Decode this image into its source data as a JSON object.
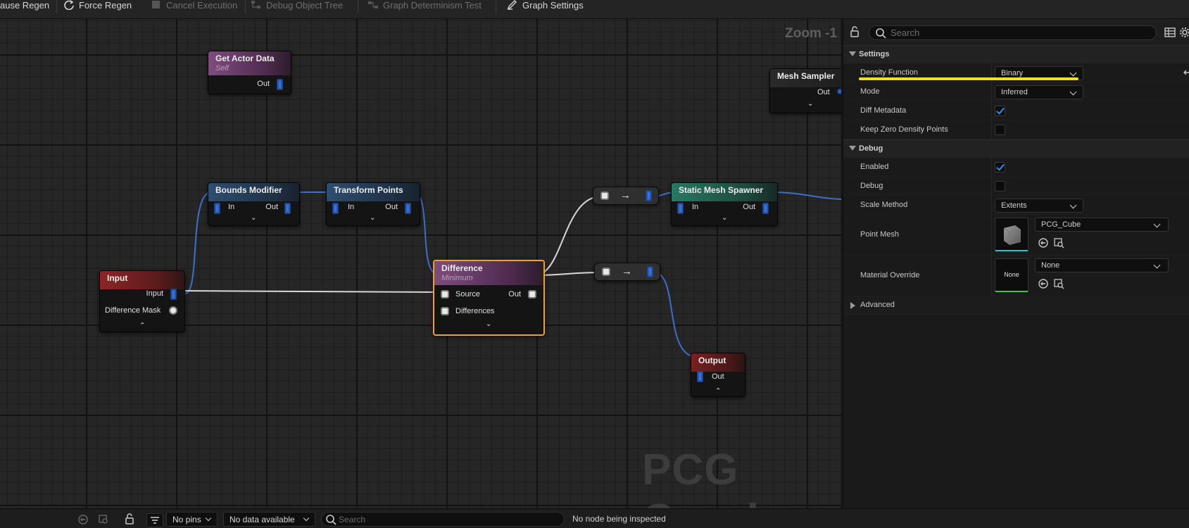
{
  "toolbar": {
    "pause_regen": "ause Regen",
    "force_regen": "Force Regen",
    "cancel_execution": "Cancel Execution",
    "debug_object_tree": "Debug Object Tree",
    "graph_determinism_test": "Graph Determinism Test",
    "graph_settings": "Graph Settings"
  },
  "graph": {
    "zoom": "Zoom -1",
    "watermark": "PCG Graph",
    "nodes": {
      "get_actor_data": {
        "title": "Get Actor Data",
        "subtitle": "Self",
        "out": "Out"
      },
      "mesh_sampler": {
        "title": "Mesh Sampler",
        "out": "Out"
      },
      "bounds_modifier": {
        "title": "Bounds Modifier",
        "in": "In",
        "out": "Out"
      },
      "transform_points": {
        "title": "Transform Points",
        "in": "In",
        "out": "Out"
      },
      "static_mesh_spawner": {
        "title": "Static Mesh Spawner",
        "in": "In",
        "out": "Out"
      },
      "input": {
        "title": "Input",
        "pin_input": "Input",
        "pin_mask": "Difference Mask"
      },
      "difference": {
        "title": "Difference",
        "subtitle": "Minimum",
        "source": "Source",
        "differences": "Differences",
        "out": "Out"
      },
      "output": {
        "title": "Output",
        "out": "Out"
      }
    }
  },
  "details": {
    "search_placeholder": "Search",
    "sections": {
      "settings": "Settings",
      "debug": "Debug",
      "advanced": "Advanced"
    },
    "settings": {
      "density_function": {
        "label": "Density Function",
        "value": "Binary"
      },
      "mode": {
        "label": "Mode",
        "value": "Inferred"
      },
      "diff_metadata": {
        "label": "Diff Metadata",
        "checked": true
      },
      "keep_zero_density": {
        "label": "Keep Zero Density Points",
        "checked": false
      }
    },
    "debug": {
      "enabled": {
        "label": "Enabled",
        "checked": true
      },
      "debug": {
        "label": "Debug",
        "checked": false
      },
      "scale_method": {
        "label": "Scale Method",
        "value": "Extents"
      },
      "point_mesh": {
        "label": "Point Mesh",
        "value": "PCG_Cube"
      },
      "material_override": {
        "label": "Material Override",
        "value": "None",
        "thumb": "None"
      }
    },
    "highlight_color": "#f2e21a"
  },
  "bottombar": {
    "pins_filter": "No pins",
    "data_filter": "No data available",
    "search_placeholder": "Search",
    "status": "No node being inspected"
  },
  "colors": {
    "accent_blue": "#3b72d9",
    "selected_node": "#f2a120",
    "wire": "#3d6fc8"
  }
}
